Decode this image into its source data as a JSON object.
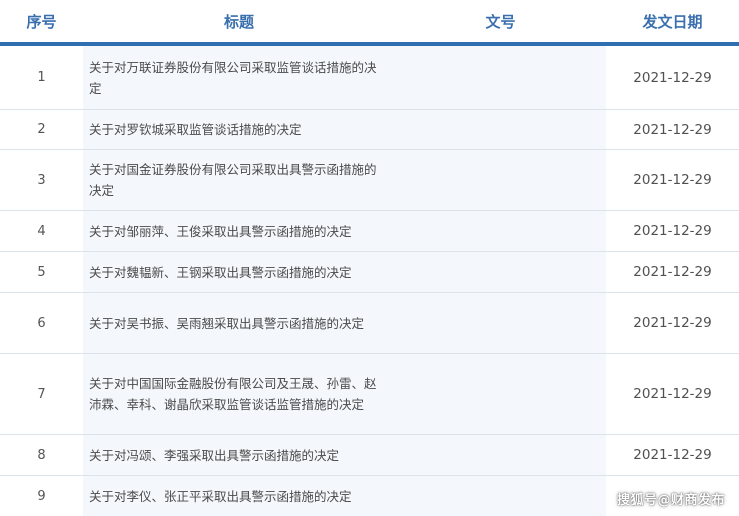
{
  "header": {
    "index": "序号",
    "title": "标题",
    "doc_no": "文号",
    "date": "发文日期"
  },
  "rows": [
    {
      "index": "1",
      "title": "关于对万联证券股份有限公司采取监管谈话措施的决定",
      "doc_no": "",
      "date": "2021-12-29"
    },
    {
      "index": "2",
      "title": "关于对罗钦城采取监管谈话措施的决定",
      "doc_no": "",
      "date": "2021-12-29"
    },
    {
      "index": "3",
      "title": "关于对国金证券股份有限公司采取出具警示函措施的决定",
      "doc_no": "",
      "date": "2021-12-29"
    },
    {
      "index": "4",
      "title": "关于对邹丽萍、王俊采取出具警示函措施的决定",
      "doc_no": "",
      "date": "2021-12-29"
    },
    {
      "index": "5",
      "title": "关于对魏韫新、王钢采取出具警示函措施的决定",
      "doc_no": "",
      "date": "2021-12-29"
    },
    {
      "index": "6",
      "title": "关于对吴书振、吴雨翘采取出具警示函措施的决定",
      "doc_no": "",
      "date": "2021-12-29"
    },
    {
      "index": "7",
      "title": "关于对中国国际金融股份有限公司及王晟、孙雷、赵沛霖、幸科、谢晶欣采取监管谈话监管措施的决定",
      "doc_no": "",
      "date": "2021-12-29"
    },
    {
      "index": "8",
      "title": "关于对冯颂、李强采取出具警示函措施的决定",
      "doc_no": "",
      "date": "2021-12-29"
    },
    {
      "index": "9",
      "title": "关于对李仪、张正平采取出具警示函措施的决定",
      "doc_no": "",
      "date": ""
    }
  ],
  "watermark": "搜狐号@财商发布",
  "colors": {
    "accent": "#2f6eb0",
    "header_text": "#3a6fae",
    "title_bg": "#f4f8fc"
  }
}
